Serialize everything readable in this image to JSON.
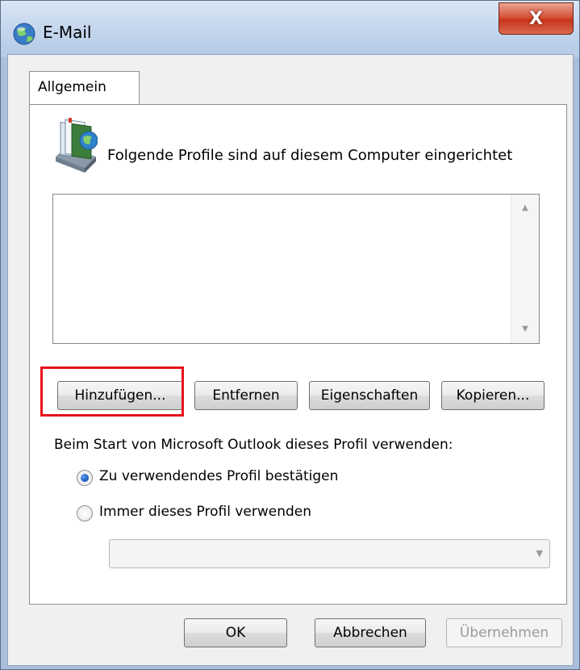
{
  "window": {
    "title": "E-Mail",
    "close_label": "X"
  },
  "tabs": [
    {
      "label": "Allgemein",
      "selected": true
    }
  ],
  "profiles": {
    "heading": "Folgende Profile sind auf diesem Computer eingerichtet",
    "items": []
  },
  "actions": {
    "add": "Hinzufügen...",
    "remove": "Entfernen",
    "properties": "Eigenschaften",
    "copy": "Kopieren..."
  },
  "startup": {
    "label": "Beim Start von Microsoft Outlook dieses Profil verwenden:",
    "options": [
      {
        "label": "Zu verwendendes Profil bestätigen",
        "checked": true
      },
      {
        "label": "Immer dieses Profil verwenden",
        "checked": false
      }
    ],
    "selected_profile": ""
  },
  "footer": {
    "ok": "OK",
    "cancel": "Abbrechen",
    "apply": "Übernehmen",
    "apply_enabled": false
  },
  "colors": {
    "highlight": "#e8101c",
    "close_button": "#c7351a",
    "radio_selected": "#1f5fbf"
  },
  "icons": {
    "app": "outlook-globe-icon",
    "profiles": "profile-cards-icon"
  }
}
